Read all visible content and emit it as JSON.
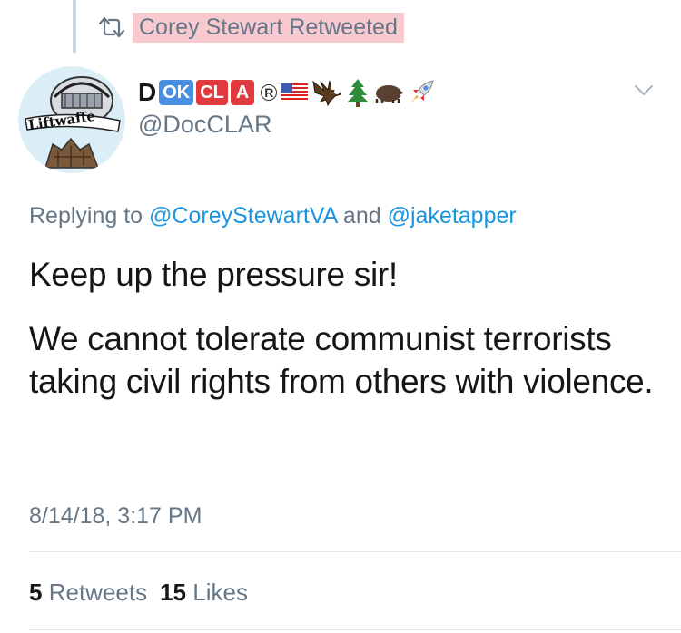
{
  "retweet_banner": {
    "text": "Corey Stewart Retweeted",
    "icon": "retweet-icon"
  },
  "author": {
    "name_letter_d": "D",
    "badges": [
      "OK",
      "CL",
      "A"
    ],
    "badge_colors": {
      "ok": "#4a90e2",
      "cl": "#e03a3e",
      "a": "#e03a3e"
    },
    "registered_mark": "R",
    "emojis": [
      "flag-usa",
      "eagle",
      "evergreen-tree",
      "boar",
      "rocket"
    ],
    "handle": "@DocCLAR",
    "avatar_icon": "helmet-logo-avatar"
  },
  "reply_to": {
    "prefix": "Replying to",
    "mention_1": "@CoreyStewartVA",
    "joiner": "and",
    "mention_2": "@jaketapper"
  },
  "tweet": {
    "paragraph_1": "Keep up the pressure sir!",
    "paragraph_2": "We cannot tolerate communist terrorists taking civil rights from others with violence."
  },
  "timestamp": "8/14/18, 3:17 PM",
  "stats": {
    "retweets_count": "5",
    "retweets_label": "Retweets",
    "likes_count": "15",
    "likes_label": "Likes"
  },
  "colors": {
    "link": "#1b95e0",
    "muted": "#657786",
    "highlight": "#f8c9cf"
  }
}
